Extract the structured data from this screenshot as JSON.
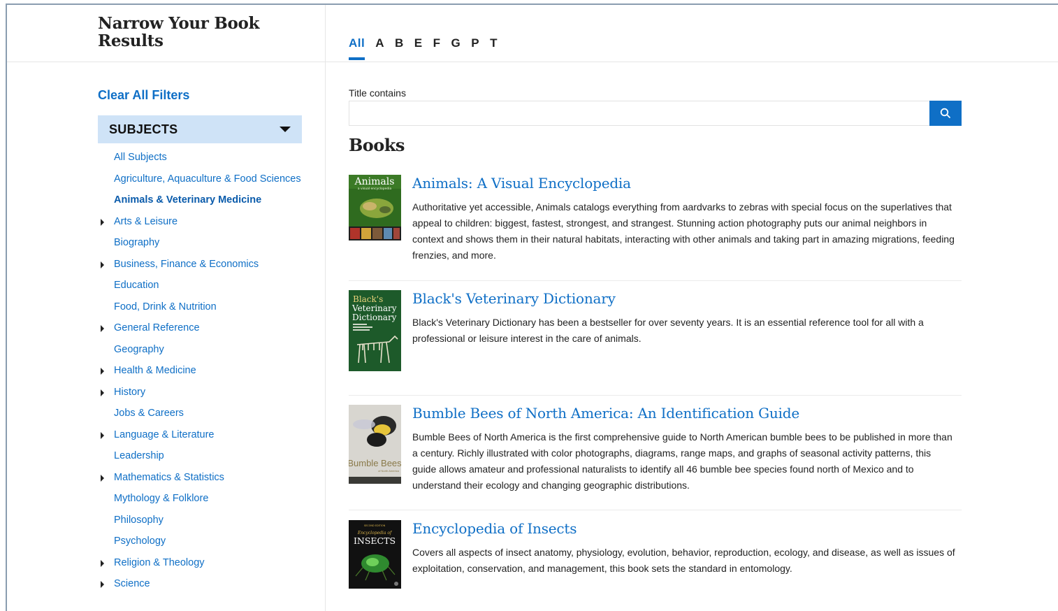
{
  "sidebar": {
    "title": "Narrow Your Book Results",
    "clear_all": "Clear All Filters",
    "section_label": "SUBJECTS",
    "subjects": [
      {
        "label": "All Subjects",
        "expandable": false,
        "active": false
      },
      {
        "label": "Agriculture, Aquaculture & Food Sciences",
        "expandable": false,
        "active": false
      },
      {
        "label": "Animals & Veterinary Medicine",
        "expandable": false,
        "active": true
      },
      {
        "label": "Arts & Leisure",
        "expandable": true,
        "active": false
      },
      {
        "label": "Biography",
        "expandable": false,
        "active": false
      },
      {
        "label": "Business, Finance & Economics",
        "expandable": true,
        "active": false
      },
      {
        "label": "Education",
        "expandable": false,
        "active": false
      },
      {
        "label": "Food, Drink & Nutrition",
        "expandable": false,
        "active": false
      },
      {
        "label": "General Reference",
        "expandable": true,
        "active": false
      },
      {
        "label": "Geography",
        "expandable": false,
        "active": false
      },
      {
        "label": "Health & Medicine",
        "expandable": true,
        "active": false
      },
      {
        "label": "History",
        "expandable": true,
        "active": false
      },
      {
        "label": "Jobs & Careers",
        "expandable": false,
        "active": false
      },
      {
        "label": "Language & Literature",
        "expandable": true,
        "active": false
      },
      {
        "label": "Leadership",
        "expandable": false,
        "active": false
      },
      {
        "label": "Mathematics & Statistics",
        "expandable": true,
        "active": false
      },
      {
        "label": "Mythology & Folklore",
        "expandable": false,
        "active": false
      },
      {
        "label": "Philosophy",
        "expandable": false,
        "active": false
      },
      {
        "label": "Psychology",
        "expandable": false,
        "active": false
      },
      {
        "label": "Religion & Theology",
        "expandable": true,
        "active": false
      },
      {
        "label": "Science",
        "expandable": true,
        "active": false
      }
    ]
  },
  "tabs": {
    "items": [
      "All",
      "A",
      "B",
      "E",
      "F",
      "G",
      "P",
      "T"
    ],
    "active": "All"
  },
  "search": {
    "label": "Title contains",
    "value": "",
    "placeholder": "",
    "icon": "search-icon"
  },
  "results": {
    "heading": "Books",
    "books": [
      {
        "title": "Animals: A Visual Encyclopedia",
        "description": "Authoritative yet accessible, Animals catalogs everything from aardvarks to zebras with special focus on the superlatives that appeal to children: biggest, fastest, strongest, and strangest. Stunning action photography puts our animal neighbors in context and shows them in their natural habitats, interacting with other animals and taking part in amazing migrations, feeding frenzies, and more.",
        "cover_text": [
          "Animals",
          "a visual encyclopedia"
        ]
      },
      {
        "title": "Black's Veterinary Dictionary",
        "description": "Black's Veterinary Dictionary has been a bestseller for over seventy years. It is an essential reference tool for all with a professional or leisure interest in the care of animals.",
        "cover_text": [
          "Black's",
          "Veterinary",
          "Dictionary"
        ]
      },
      {
        "title": "Bumble Bees of North America: An Identification Guide",
        "description": "Bumble Bees of North America is the first comprehensive guide to North American bumble bees to be published in more than a century. Richly illustrated with color photographs, diagrams, range maps, and graphs of seasonal activity patterns, this guide allows amateur and professional naturalists to identify all 46 bumble bee species found north of Mexico and to understand their ecology and changing geographic distributions.",
        "cover_text": [
          "Bumble Bees",
          "of North America"
        ]
      },
      {
        "title": "Encyclopedia of Insects",
        "description": "Covers all aspects of insect anatomy, physiology, evolution, behavior, reproduction, ecology, and disease, as well as issues of exploitation, conservation, and management, this book sets the standard in entomology.",
        "cover_text": [
          "SECOND EDITION",
          "Encyclopedia of",
          "INSECTS"
        ]
      }
    ]
  },
  "colors": {
    "accent": "#0f6fc6",
    "subjects_bg": "#cfe3f7"
  }
}
